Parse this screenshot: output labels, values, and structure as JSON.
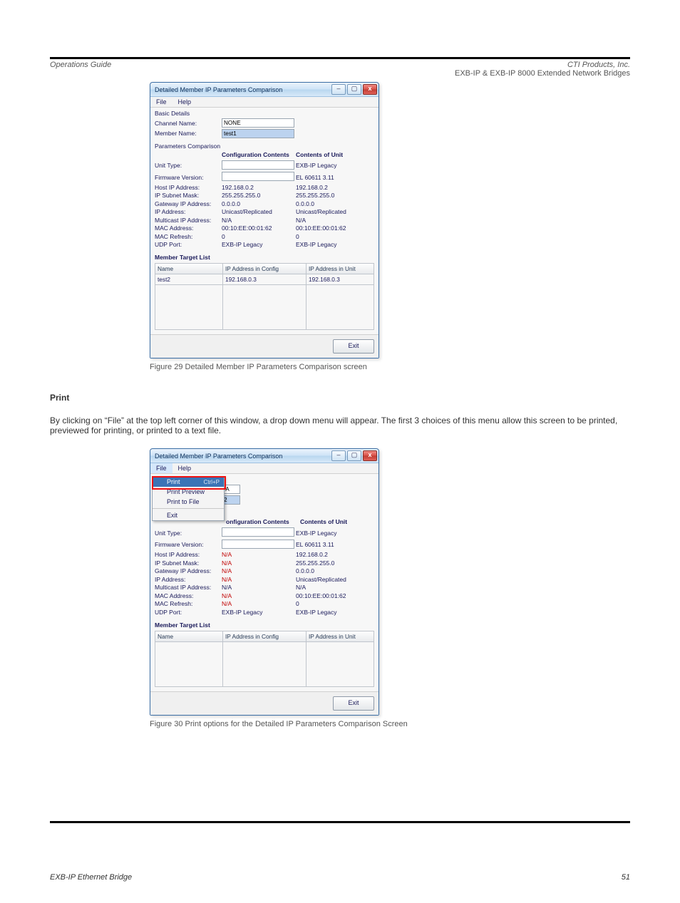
{
  "doc": {
    "header_left": "Operations Guide",
    "header_right": "CTI Products, Inc.",
    "intro_right": "EXB-IP & EXB-IP 8000 Extended Network Bridges",
    "caption1": "Figure 29  Detailed Member IP Parameters Comparison screen",
    "print_line1": "Print",
    "print_line2": "By clicking on “File” at the top left corner of this window, a drop down menu will appear. The first 3 choices of this menu allow this screen to be printed, previewed for printing, or printed to a text file.",
    "caption2": "Figure 30  Print options for the Detailed IP Parameters Comparison Screen",
    "footer_left": "EXB-IP Ethernet Bridge",
    "footer_center": "",
    "footer_right": "51"
  },
  "win": {
    "title": "Detailed Member IP Parameters Comparison",
    "menus": [
      "File",
      "Help"
    ],
    "basic_details": "Basic Details",
    "channel_name_lbl": "Channel Name:",
    "member_name_lbl": "Member Name:",
    "params_comp_lbl": "Parameters Comparison",
    "hdr_conf": "Configuration Contents",
    "hdr_unit": "Contents of Unit",
    "row_labels": {
      "unit_type": "Unit Type:",
      "firmware": "Firmware Version:",
      "host_ip": "Host IP Address:",
      "subnet": "IP Subnet Mask:",
      "gateway": "Gateway IP Address:",
      "ip_addr": "IP Address:",
      "mcast": "Multicast IP Address:",
      "mac": "MAC Address:",
      "mac_ref": "MAC Refresh:",
      "udp": "UDP Port:"
    },
    "member_target_list": "Member Target List",
    "list_hdr": {
      "name": "Name",
      "conf": "IP Address in Config",
      "unit": "IP Address in Unit"
    },
    "exit_btn": "Exit"
  },
  "top_window": {
    "channel_name": "NONE",
    "member_name": "test1",
    "rows": {
      "unit_type": {
        "conf_input": "",
        "unit": "EXB-IP Legacy"
      },
      "firmware": {
        "conf_input": "",
        "unit": "EL 60611 3.11"
      },
      "host_ip": {
        "conf": "192.168.0.2",
        "unit": "192.168.0.2"
      },
      "subnet": {
        "conf": "255.255.255.0",
        "unit": "255.255.255.0"
      },
      "gateway": {
        "conf": "0.0.0.0",
        "unit": "0.0.0.0"
      },
      "ip_addr": {
        "conf": "Unicast/Replicated",
        "unit": "Unicast/Replicated"
      },
      "mcast": {
        "conf": "N/A",
        "unit": "N/A"
      },
      "mac": {
        "conf": "00:10:EE:00:01:62",
        "unit": "00:10:EE:00:01:62"
      },
      "mac_ref": {
        "conf": "0",
        "unit": "0"
      },
      "udp": {
        "conf": "EXB-IP Legacy",
        "unit": "EXB-IP Legacy"
      }
    },
    "list_rows": [
      {
        "name": "test2",
        "conf": "192.168.0.3",
        "unit": "192.168.0.3"
      }
    ]
  },
  "bottom_window": {
    "file_menu": [
      {
        "label": "Print",
        "shortcut": "Ctrl+P",
        "highlight": true
      },
      {
        "label": "Print Preview",
        "shortcut": ""
      },
      {
        "label": "Print to File",
        "shortcut": ""
      },
      {
        "sep": true
      },
      {
        "label": "Exit",
        "shortcut": ""
      }
    ],
    "peek_channel": "/A",
    "peek_member": "2",
    "rows": {
      "unit_type": {
        "conf_input": "",
        "unit": "EXB-IP Legacy"
      },
      "firmware": {
        "conf_input": "",
        "unit": "EL 60611 3.11"
      },
      "host_ip": {
        "conf": "N/A",
        "red": true,
        "unit": "192.168.0.2"
      },
      "subnet": {
        "conf": "N/A",
        "red": true,
        "unit": "255.255.255.0"
      },
      "gateway": {
        "conf": "N/A",
        "red": true,
        "unit": "0.0.0.0"
      },
      "ip_addr": {
        "conf": "N/A",
        "red": true,
        "unit": "Unicast/Replicated"
      },
      "mcast": {
        "conf": "N/A",
        "unit": "N/A"
      },
      "mac": {
        "conf": "N/A",
        "red": true,
        "unit": "00:10:EE:00:01:62"
      },
      "mac_ref": {
        "conf": "N/A",
        "red": true,
        "unit": "0"
      },
      "udp": {
        "conf": "EXB-IP Legacy",
        "unit": "EXB-IP Legacy"
      }
    },
    "list_rows": []
  }
}
